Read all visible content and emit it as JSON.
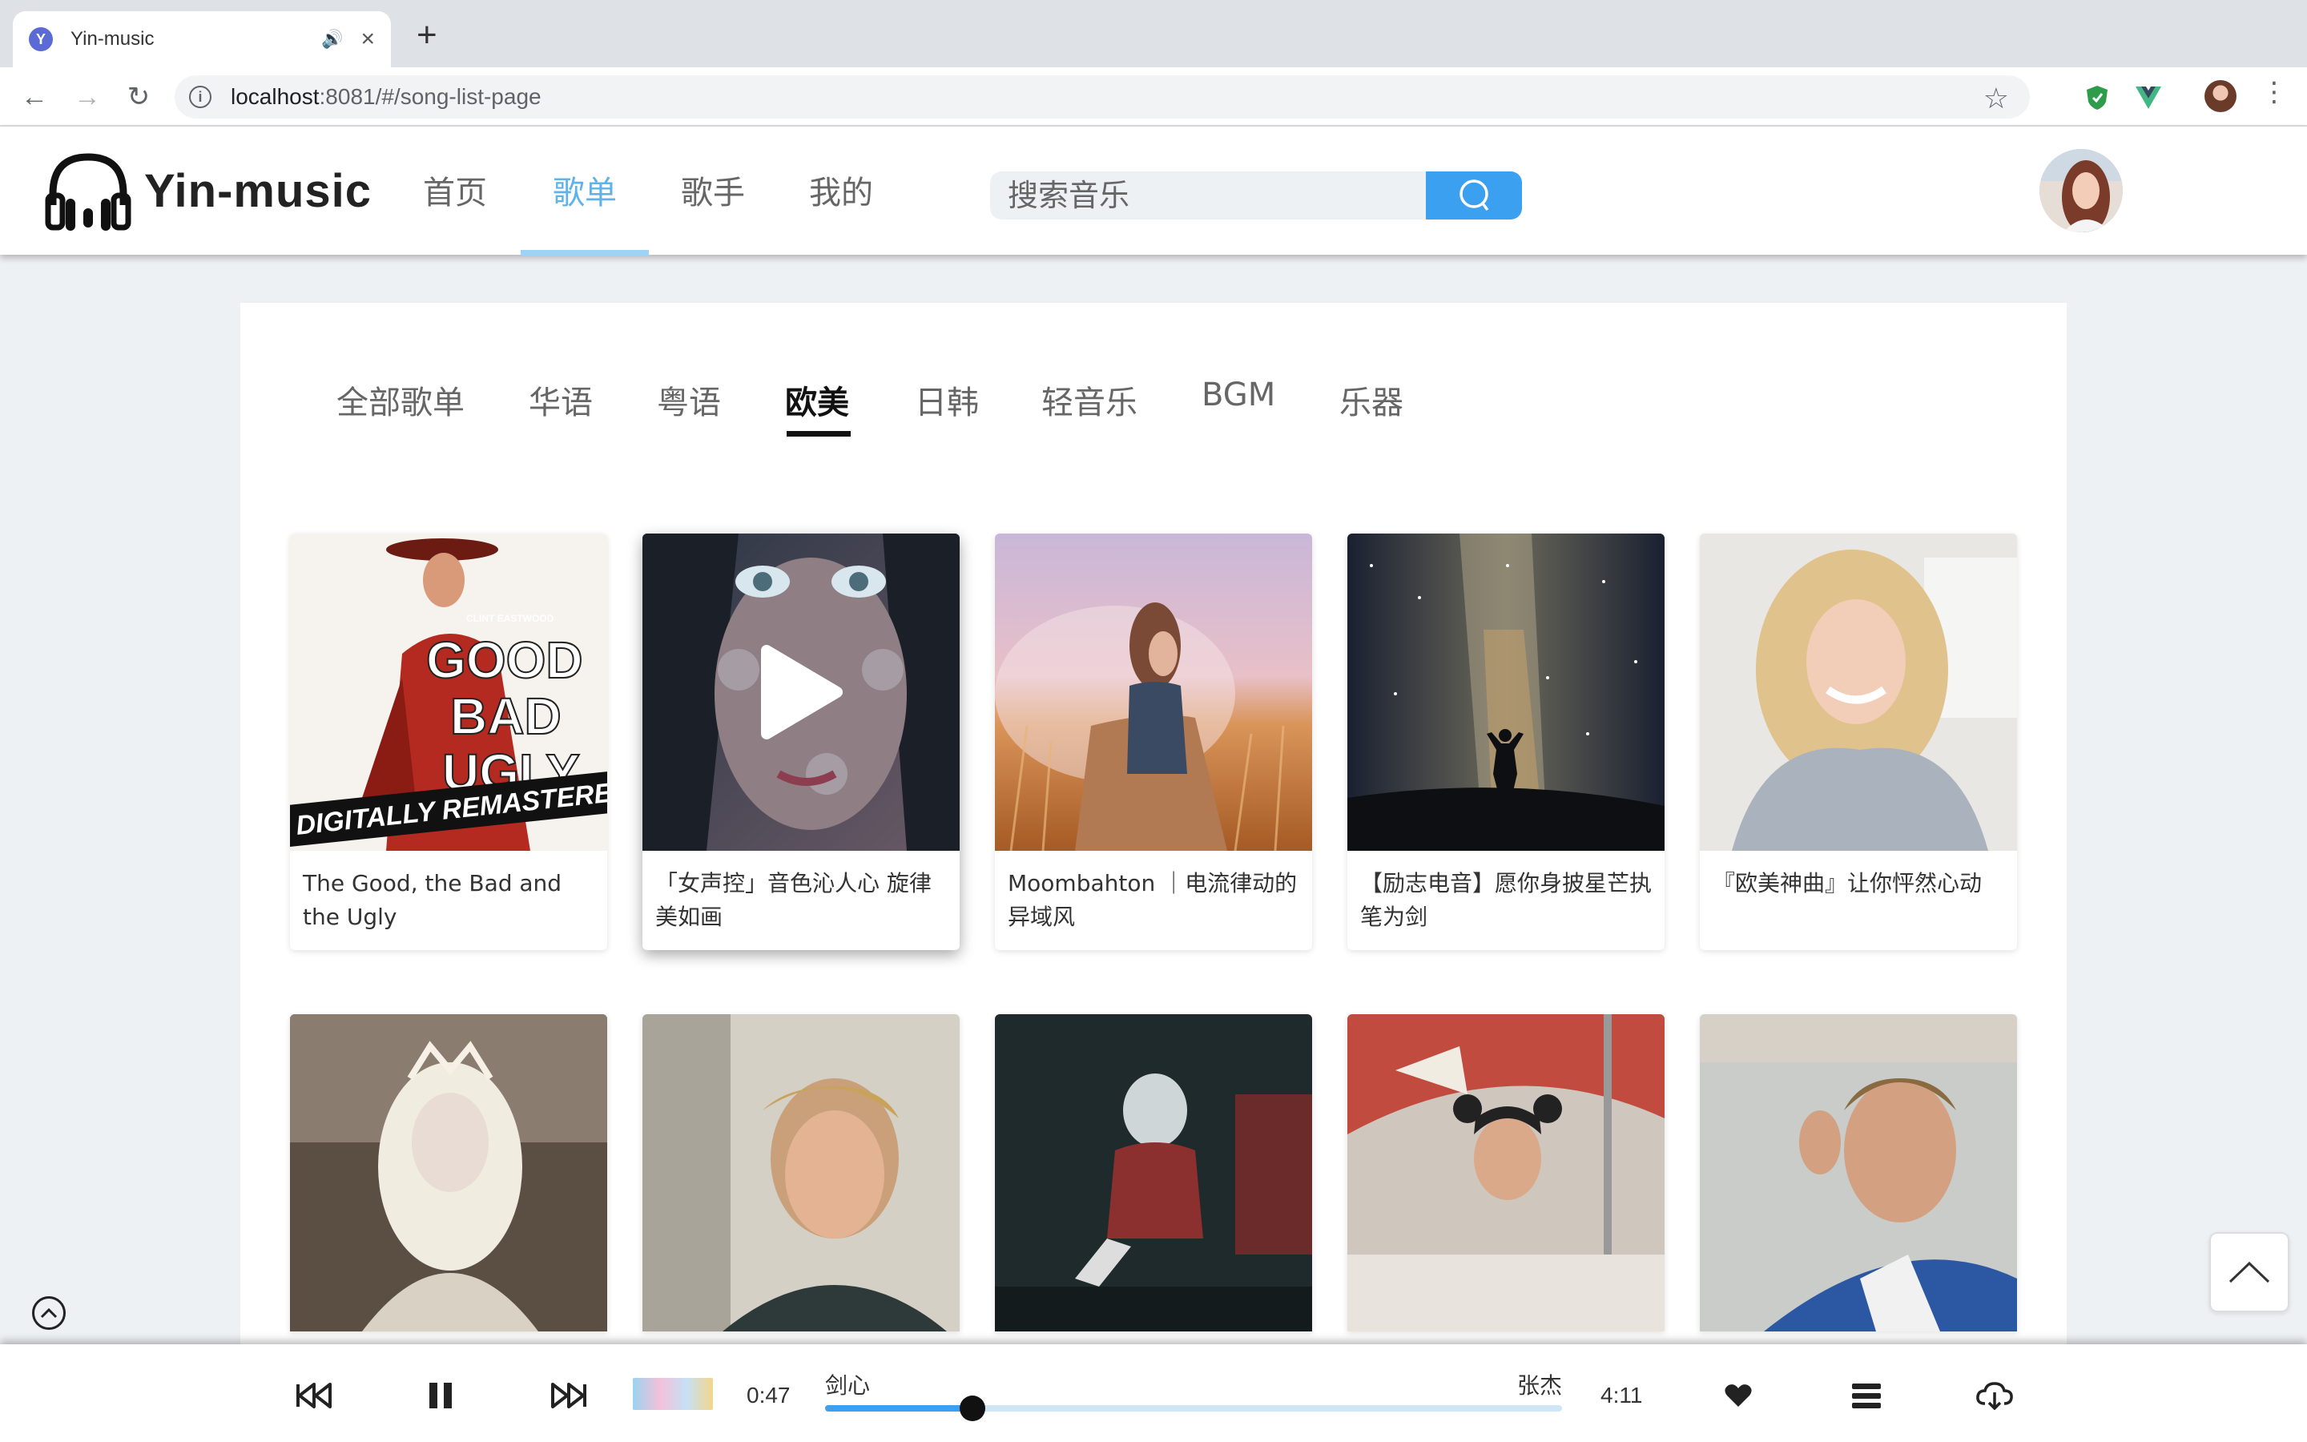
{
  "browser": {
    "tab_title": "Yin-music",
    "url_host": "localhost",
    "url_rest": ":8081/#/song-list-page"
  },
  "header": {
    "logo_text": "Yin-music",
    "nav": [
      "首页",
      "歌单",
      "歌手",
      "我的"
    ],
    "active_nav": "歌单",
    "search_placeholder": "搜索音乐"
  },
  "categories": {
    "items": [
      "全部歌单",
      "华语",
      "粤语",
      "欧美",
      "日韩",
      "轻音乐",
      "BGM",
      "乐器"
    ],
    "active": "欧美"
  },
  "playlists_row1": [
    "The Good, the Bad and the Ugly",
    "「女声控」音色沁人心 旋律美如画",
    "Moombahton ｜电流律动的异域风",
    "【励志电音】愿你身披星芒执笔为剑",
    "『欧美神曲』让你怦然心动"
  ],
  "cover_text": {
    "top": "CLINT EASTWOOD",
    "title": "GOOD BAD UGLY",
    "banner": "DIGITALLY REMASTERED"
  },
  "player": {
    "current_time": "0:47",
    "song": "剑心",
    "singer": "张杰",
    "duration": "4:11",
    "progress": 0.2
  },
  "colors": {
    "accent": "#3aa0ef",
    "nav_active": "#5fb3e8"
  }
}
